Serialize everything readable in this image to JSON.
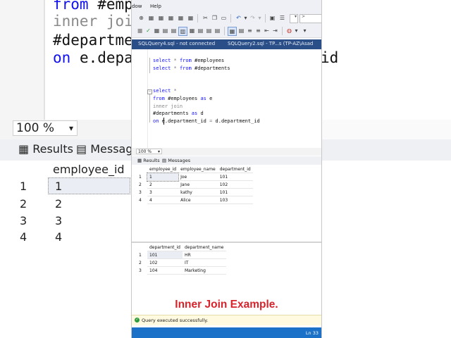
{
  "background": {
    "code_lines": [
      {
        "kw": "from",
        "rest": " #empl"
      },
      {
        "kw": "",
        "gray": "inner joi"
      },
      {
        "kw": "",
        "rest": "#departmen"
      },
      {
        "kw": "on",
        "rest": " e.depar"
      }
    ],
    "right_text": "id",
    "zoom": "100 %",
    "tabs": {
      "results": "Results",
      "messages": "Message"
    },
    "column": "employee_id",
    "rows": [
      [
        "1",
        "1"
      ],
      [
        "2",
        "2"
      ],
      [
        "3",
        "3"
      ],
      [
        "4",
        "4"
      ]
    ]
  },
  "menu": {
    "window": "dow",
    "help": "Help"
  },
  "toolbar": {
    "search_prefix": ">"
  },
  "doc_tabs": {
    "tab1": "SQLQuery4.sql - not connected",
    "tab2": "SQLQuery2.sql - TP...s (TP-AZ\\Asad"
  },
  "editor": {
    "line1": {
      "kw1": "select",
      "op": " * ",
      "kw2": "from",
      "rest": " #employees"
    },
    "line2": {
      "kw1": "select",
      "op": " * ",
      "kw2": "from",
      "rest": " #departments"
    },
    "line3": {
      "kw1": "select",
      "op": " *"
    },
    "line4": {
      "kw1": "from",
      "rest": " #employees ",
      "kw2": "as",
      "rest2": " e"
    },
    "line5": {
      "gray": "inner join"
    },
    "line6": {
      "rest": "#departments ",
      "kw1": "as",
      "rest2": " d"
    },
    "line7": {
      "kw1": "on",
      "rest": " e.department_id ",
      "op": "=",
      "rest2": " d.department_id"
    }
  },
  "zoom": "100 %",
  "results_tabs": {
    "results": "Results",
    "messages": "Messages"
  },
  "employees_grid": {
    "headers": [
      "employee_id",
      "employee_name",
      "department_id"
    ],
    "rows": [
      [
        "1",
        "1",
        "Joe",
        "101"
      ],
      [
        "2",
        "2",
        "Jane",
        "102"
      ],
      [
        "3",
        "3",
        "kathy",
        "101"
      ],
      [
        "4",
        "4",
        "Alice",
        "103"
      ]
    ]
  },
  "departments_grid": {
    "headers": [
      "department_id",
      "department_name"
    ],
    "rows": [
      [
        "1",
        "101",
        "HR"
      ],
      [
        "2",
        "102",
        "IT"
      ],
      [
        "3",
        "104",
        "Marketing"
      ]
    ]
  },
  "caption": "Inner Join Example.",
  "status": {
    "message": "Query executed successfully.",
    "line": "Ln 33"
  },
  "colors": {
    "accent_blue": "#1a71c7",
    "caption_red": "#d6232c",
    "keyword_blue": "#1010ff"
  }
}
